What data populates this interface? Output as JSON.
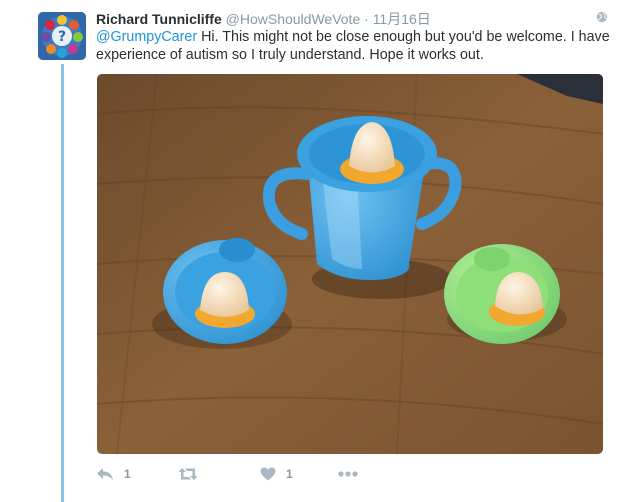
{
  "tweet": {
    "author_name": "Richard Tunnicliffe",
    "author_handle": "@HowShouldWeVote",
    "separator": "·",
    "timestamp": "11月16日",
    "mention": "@GrumpyCarer",
    "text": " Hi. This might not be close enough but you'd be welcome. I have experience of autism so I truly understand. Hope it works out.",
    "image_alt": "Blue sippy cup and two lids on wooden table"
  },
  "actions": {
    "reply_count": "1",
    "like_count": "1"
  },
  "colors": {
    "link": "#1b95e0",
    "thread_line": "#8ac1dd",
    "muted": "#8899a6",
    "icon": "#aab8c2"
  },
  "icons": {
    "reply": "reply-icon",
    "retweet": "retweet-icon",
    "like": "heart-icon",
    "more": "more-icon",
    "globe": "globe-icon"
  }
}
